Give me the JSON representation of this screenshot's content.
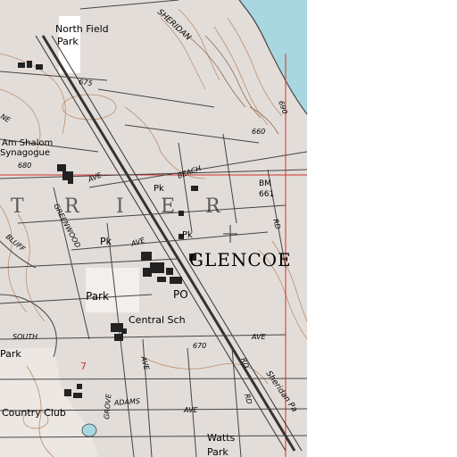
{
  "map": {
    "colors": {
      "urban_tint": "#e3ddd9",
      "water": "#a8d7e0",
      "blank": "#ffffff",
      "contour": "#b98f6f",
      "section_line": "#cc3333",
      "road": "#333333"
    },
    "labels": {
      "north_field_park": [
        "North Field",
        "Park"
      ],
      "am_shalom": [
        "Am Shalom",
        "Synagogue"
      ],
      "elev_675": "675",
      "elev_680": "680",
      "elev_660": "660",
      "elev_670": "670",
      "elev_690": "690",
      "sheridan_top": "SHERIDAN",
      "sheridan_bottom": "Sheridan Pa",
      "ave_1": "AVE",
      "greenwood": "GREENWOOD",
      "bluff": "BLUFF",
      "beach": "BEACH",
      "rd_1": "RD",
      "rd_2": "RD",
      "ave_2": "AVE",
      "pk_1": "Pk",
      "pk_2": "Pk",
      "pk_3": "Pk",
      "bm": [
        "BM",
        "661"
      ],
      "glencoe": "GLENCOE",
      "trier_letters": [
        "T",
        "R",
        "I",
        "E",
        "R"
      ],
      "park": "Park",
      "po": "PO",
      "central_sch": "Central Sch",
      "south": "SOUTH",
      "ave_3": "AVE",
      "park_left": "Park",
      "number_7": "7",
      "country_club": "Country Club",
      "adams": "ADAMS",
      "ave_4": "AVE",
      "grove": "GROVE",
      "watts": "Watts",
      "watts_park": "Park",
      "ne": "NE",
      "rd_3": "RD"
    }
  }
}
